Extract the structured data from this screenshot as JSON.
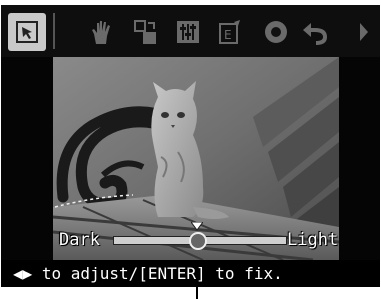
{
  "toolbar": {
    "items": [
      {
        "icon": "select-arrow-icon",
        "state": "selected"
      },
      {
        "icon": "hand-icon",
        "state": "disabled"
      },
      {
        "icon": "rotate-resize-icon",
        "state": "disabled"
      },
      {
        "icon": "adjust-sliders-icon",
        "state": "disabled"
      },
      {
        "icon": "edit-export-icon",
        "state": "disabled"
      },
      {
        "icon": "red-eye-icon",
        "state": "disabled"
      },
      {
        "icon": "undo-icon",
        "state": "disabled"
      },
      {
        "icon": "next-arrow-icon",
        "state": "disabled"
      }
    ]
  },
  "slider": {
    "left_label": "Dark",
    "right_label": "Light",
    "value": 0.5
  },
  "hint": {
    "arrows": "◀▶",
    "text": " to adjust/[ENTER] to fix."
  },
  "colors": {
    "selected_bg": "#c9c9c9",
    "disabled_icon": "#6a6a6a",
    "text": "#ffffff"
  }
}
